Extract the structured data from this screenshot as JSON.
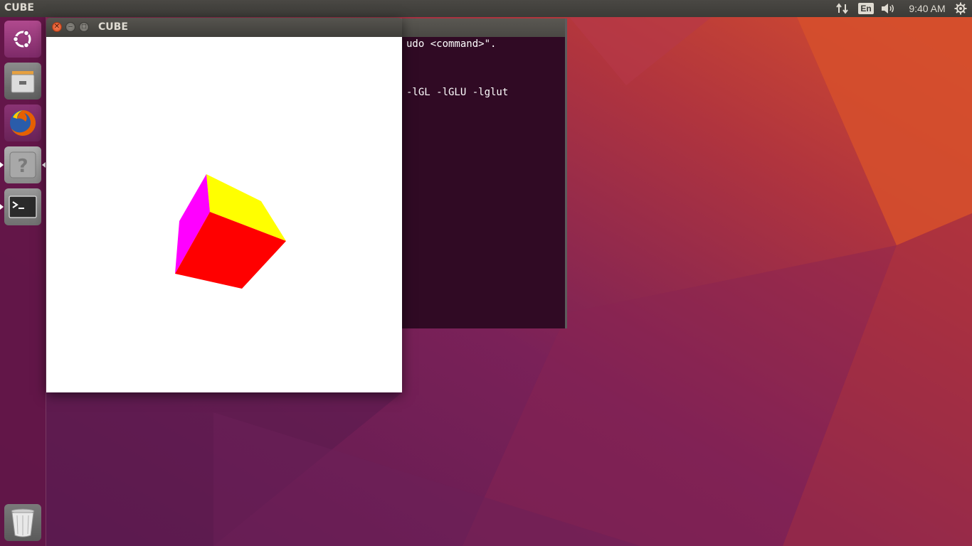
{
  "top_panel": {
    "app_name": "CUBE",
    "keyboard_layout": "En",
    "clock": "9:40 AM",
    "icons": [
      "network-icon",
      "sound-icon",
      "system-gear-icon"
    ]
  },
  "launcher": {
    "items": [
      {
        "name": "ubuntu-dash",
        "icon": "ubuntu-logo-icon"
      },
      {
        "name": "files",
        "icon": "file-cabinet-icon"
      },
      {
        "name": "firefox",
        "icon": "firefox-icon"
      },
      {
        "name": "help",
        "icon": "question-mark-icon"
      },
      {
        "name": "terminal",
        "icon": "terminal-icon"
      },
      {
        "name": "trash",
        "icon": "trash-icon"
      }
    ]
  },
  "terminal": {
    "lines": [
      "udo <command>\".",
      "-lGL -lGLU -lglut"
    ]
  },
  "cube_window": {
    "title": "CUBE",
    "colors": {
      "background": "#ffffff",
      "top_face": "#ffff00",
      "front_face": "#ff0000",
      "left_face": "#ff00ff"
    }
  },
  "colors": {
    "panel": "#3c3b37",
    "terminal_bg": "#300a24",
    "wallpaper_warm": "#d0442e",
    "wallpaper_purple": "#6a1f55"
  }
}
